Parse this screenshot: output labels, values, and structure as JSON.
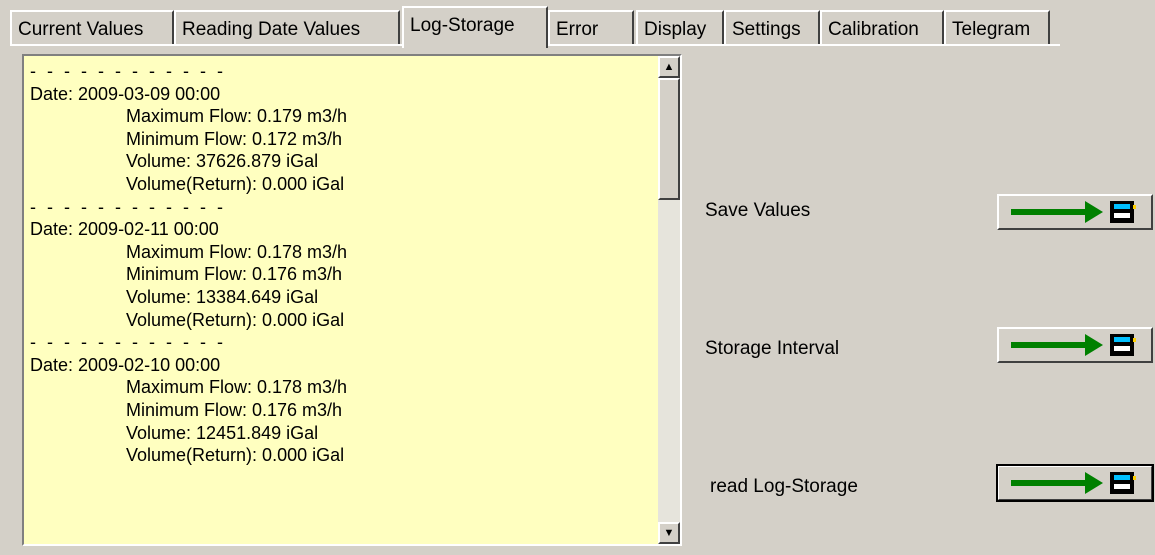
{
  "tabs": [
    {
      "label": "Current Values",
      "active": false
    },
    {
      "label": "Reading Date Values",
      "active": false
    },
    {
      "label": "Log-Storage",
      "active": true
    },
    {
      "label": "Error",
      "active": false
    },
    {
      "label": "Display",
      "active": false
    },
    {
      "label": "Settings",
      "active": false
    },
    {
      "label": "Calibration",
      "active": false
    },
    {
      "label": "Telegram",
      "active": false
    }
  ],
  "log": {
    "separator": "- - - - - - - - - - - -",
    "entries": [
      {
        "date": "Date: 2009-03-09 00:00",
        "max_flow": "Maximum Flow: 0.179 m3/h",
        "min_flow": "Minimum Flow: 0.172 m3/h",
        "volume": "Volume: 37626.879 iGal",
        "volume_return": "Volume(Return): 0.000 iGal"
      },
      {
        "date": "Date: 2009-02-11 00:00",
        "max_flow": "Maximum Flow: 0.178 m3/h",
        "min_flow": "Minimum Flow: 0.176 m3/h",
        "volume": "Volume: 13384.649 iGal",
        "volume_return": "Volume(Return): 0.000 iGal"
      },
      {
        "date": "Date: 2009-02-10 00:00",
        "max_flow": "Maximum Flow: 0.178 m3/h",
        "min_flow": "Minimum Flow: 0.176 m3/h",
        "volume": "Volume: 12451.849 iGal",
        "volume_return": "Volume(Return): 0.000 iGal"
      }
    ]
  },
  "scrollbar": {
    "up_icon": "scroll-up-arrow",
    "down_icon": "scroll-down-arrow"
  },
  "actions": {
    "save_values": {
      "label": "Save Values",
      "icon": "arrow-to-storage-icon"
    },
    "storage_interval": {
      "label": "Storage Interval",
      "icon": "arrow-to-storage-icon"
    },
    "read_log_storage": {
      "label": "read Log-Storage",
      "icon": "arrow-to-storage-icon"
    }
  },
  "colors": {
    "log_background": "#ffffc0",
    "arrow": "#008000",
    "storage_icon_screen": "#00c0ff",
    "storage_icon_led": "#ffd000"
  }
}
